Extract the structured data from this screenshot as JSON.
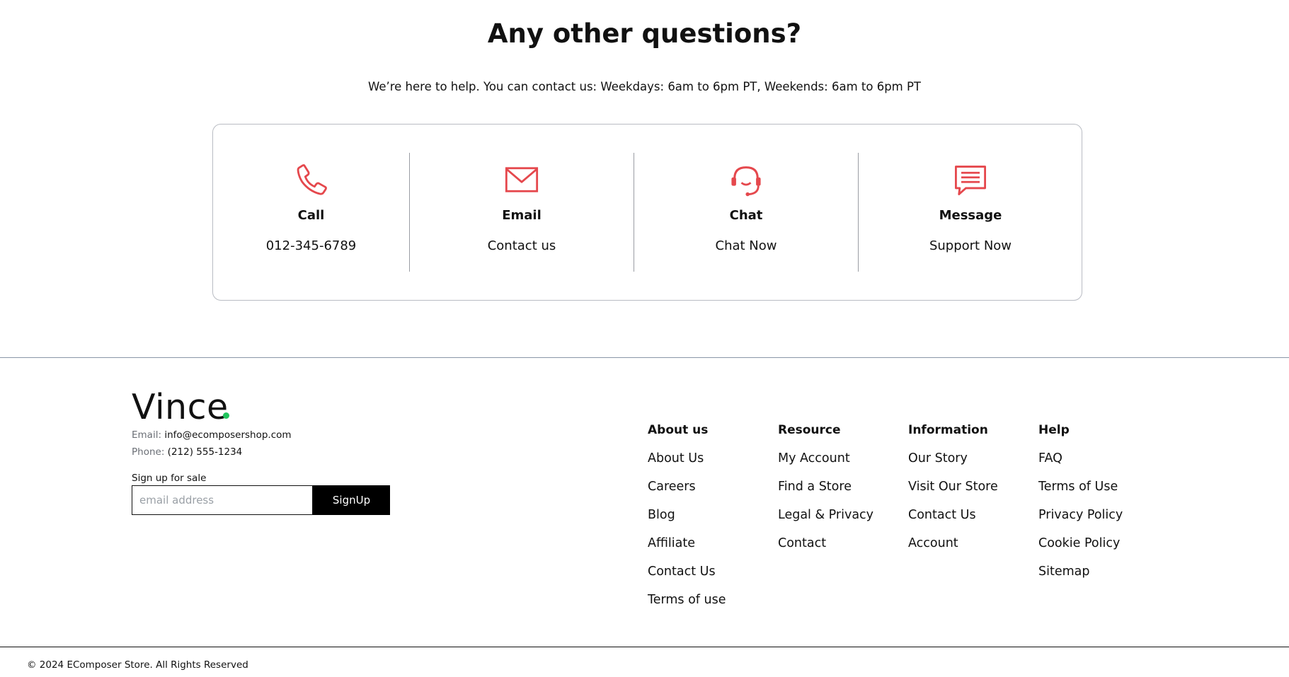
{
  "help": {
    "title": "Any other questions?",
    "subtitle": "We’re here to help. You can contact us: Weekdays: 6am to 6pm PT, Weekends: 6am to 6pm PT",
    "accent_color": "#e5484d",
    "options": [
      {
        "icon": "phone-icon",
        "label": "Call",
        "value": "012-345-6789"
      },
      {
        "icon": "envelope-icon",
        "label": "Email",
        "value": "Contact us"
      },
      {
        "icon": "headset-icon",
        "label": "Chat",
        "value": "Chat Now"
      },
      {
        "icon": "message-icon",
        "label": "Message",
        "value": "Support Now"
      }
    ]
  },
  "footer": {
    "brand": "Vince",
    "brand_dot_color": "#21c45d",
    "email_label": "Email:",
    "email": "info@ecomposershop.com",
    "phone_label": "Phone:",
    "phone": "(212) 555-1234",
    "signup_label": "Sign up for sale",
    "signup_placeholder": "email address",
    "signup_button": "SignUp",
    "columns": [
      {
        "title": "About us",
        "links": [
          "About Us",
          "Careers",
          "Blog",
          "Affiliate",
          "Contact Us",
          "Terms of use"
        ]
      },
      {
        "title": "Resource",
        "links": [
          "My Account",
          "Find a Store",
          "Legal & Privacy",
          "Contact"
        ]
      },
      {
        "title": "Information",
        "links": [
          "Our Story",
          "Visit Our Store",
          "Contact Us",
          "Account"
        ]
      },
      {
        "title": "Help",
        "links": [
          "FAQ",
          "Terms of Use",
          "Privacy Policy",
          "Cookie Policy",
          "Sitemap"
        ]
      }
    ],
    "copyright": "© 2024 EComposer Store. All Rights Reserved"
  }
}
